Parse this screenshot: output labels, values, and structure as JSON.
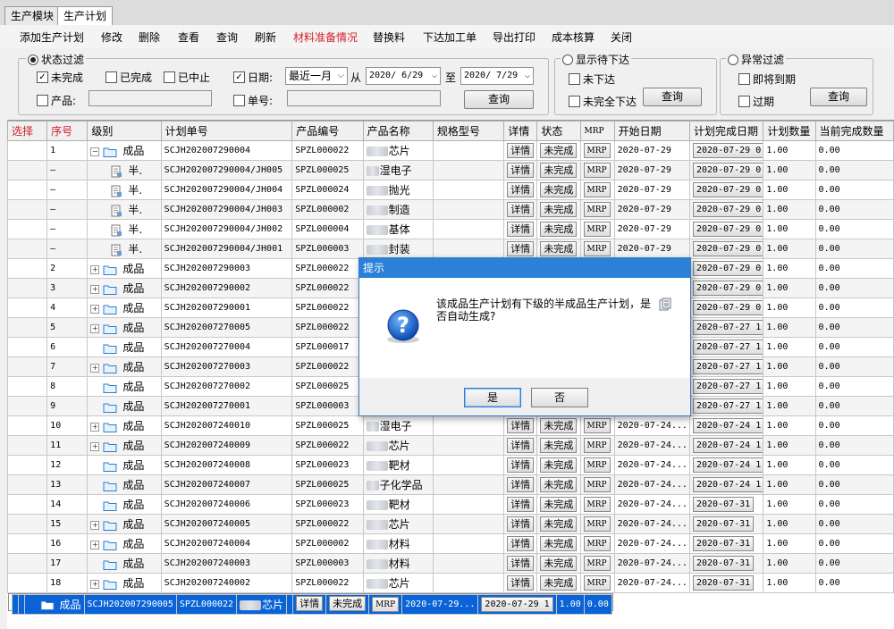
{
  "tabs": [
    "生产模块",
    "生产计划"
  ],
  "toolbar": [
    {
      "label": "添加生产计划",
      "color": "#000000"
    },
    {
      "label": "修改",
      "color": "#000000"
    },
    {
      "label": "删除",
      "color": "#000000"
    },
    {
      "label": "查看",
      "color": "#000000"
    },
    {
      "label": "查询",
      "color": "#000000"
    },
    {
      "label": "刷新",
      "color": "#000000"
    },
    {
      "label": "材料准备情况",
      "color": "#d0202a"
    },
    {
      "label": "替换料",
      "color": "#000000"
    },
    {
      "label": "下达加工单",
      "color": "#000000"
    },
    {
      "label": "导出打印",
      "color": "#000000"
    },
    {
      "label": "成本核算",
      "color": "#000000"
    },
    {
      "label": "关闭",
      "color": "#000000"
    }
  ],
  "filters": {
    "status": {
      "title": "状态过滤",
      "unfinished": "未完成",
      "completed": "已完成",
      "stopped": "已中止",
      "product_label": "产品:",
      "product_value": ""
    },
    "date": {
      "check_label": "日期:",
      "range": "最近一月",
      "from_label": "从",
      "from": "2020/ 6/29",
      "to_label": "至",
      "to": "2020/ 7/29",
      "order_label": "单号:",
      "order_value": "",
      "query": "查询"
    },
    "pending": {
      "title": "显示待下达",
      "not_issued": "未下达",
      "partial": "未完全下达",
      "query": "查询"
    },
    "abnormal": {
      "title": "异常过滤",
      "due_soon": "即将到期",
      "overdue": "过期",
      "query": "查询"
    }
  },
  "columns": [
    "选择",
    "序号",
    "级别",
    "计划单号",
    "产品编号",
    "产品名称",
    "规格型号",
    "详情",
    "状态",
    "MRP",
    "开始日期",
    "计划完成日期",
    "计划数量",
    "当前完成数量"
  ],
  "rows": [
    {
      "seq": "1",
      "level": "成品",
      "plan": "SCJH202007290004",
      "code": "SPZL000022",
      "name": "芯片",
      "detail": "详情",
      "status": "未完成",
      "mrp": "MRP",
      "start": "2020-07-29",
      "due": "2020-07-29 0",
      "qty": "1.00",
      "done": "0.00"
    },
    {
      "seq": "—",
      "level": "半.",
      "plan": "SCJH202007290004/JH005",
      "code": "SPZL000025",
      "name": "湿电子",
      "detail": "详情",
      "status": "未完成",
      "mrp": "MRP",
      "start": "2020-07-29",
      "due": "2020-07-29 0",
      "qty": "1.00",
      "done": "0.00"
    },
    {
      "seq": "—",
      "level": "半.",
      "plan": "SCJH202007290004/JH004",
      "code": "SPZL000024",
      "name": "抛光",
      "detail": "详情",
      "status": "未完成",
      "mrp": "MRP",
      "start": "2020-07-29",
      "due": "2020-07-29 0",
      "qty": "1.00",
      "done": "0.00"
    },
    {
      "seq": "—",
      "level": "半.",
      "plan": "SCJH202007290004/JH003",
      "code": "SPZL000002",
      "name": "制造",
      "detail": "详情",
      "status": "未完成",
      "mrp": "MRP",
      "start": "2020-07-29",
      "due": "2020-07-29 0",
      "qty": "1.00",
      "done": "0.00"
    },
    {
      "seq": "—",
      "level": "半.",
      "plan": "SCJH202007290004/JH002",
      "code": "SPZL000004",
      "name": "基体",
      "detail": "详情",
      "status": "未完成",
      "mrp": "MRP",
      "start": "2020-07-29",
      "due": "2020-07-29 0",
      "qty": "1.00",
      "done": "0.00"
    },
    {
      "seq": "—",
      "level": "半.",
      "plan": "SCJH202007290004/JH001",
      "code": "SPZL000003",
      "name": "封装",
      "detail": "详情",
      "status": "未完成",
      "mrp": "MRP",
      "start": "2020-07-29",
      "due": "2020-07-29 0",
      "qty": "1.00",
      "done": "0.00"
    },
    {
      "seq": "2",
      "level": "成品",
      "plan": "SCJH202007290003",
      "code": "SPZL000022",
      "name": "",
      "detail": "",
      "status": "",
      "mrp": "",
      "start": "",
      "due": "2020-07-29 0",
      "qty": "1.00",
      "done": "0.00"
    },
    {
      "seq": "3",
      "level": "成品",
      "plan": "SCJH202007290002",
      "code": "SPZL000022",
      "name": "",
      "detail": "",
      "status": "",
      "mrp": "",
      "start": "",
      "due": "2020-07-29 0",
      "qty": "1.00",
      "done": "0.00"
    },
    {
      "seq": "4",
      "level": "成品",
      "plan": "SCJH202007290001",
      "code": "SPZL000022",
      "name": "",
      "detail": "",
      "status": "",
      "mrp": "",
      "start": "",
      "due": "2020-07-29 0",
      "qty": "1.00",
      "done": "0.00"
    },
    {
      "seq": "5",
      "level": "成品",
      "plan": "SCJH202007270005",
      "code": "SPZL000022",
      "name": "",
      "detail": "",
      "status": "",
      "mrp": "",
      "start": "",
      "due": "2020-07-27 1",
      "qty": "1.00",
      "done": "0.00"
    },
    {
      "seq": "6",
      "level": "成品",
      "plan": "SCJH202007270004",
      "code": "SPZL000017",
      "name": "",
      "detail": "",
      "status": "",
      "mrp": "",
      "start": "",
      "due": "2020-07-27 1",
      "qty": "1.00",
      "done": "0.00"
    },
    {
      "seq": "7",
      "level": "成品",
      "plan": "SCJH202007270003",
      "code": "SPZL000022",
      "name": "",
      "detail": "",
      "status": "",
      "mrp": "",
      "start": "",
      "due": "2020-07-27 1",
      "qty": "1.00",
      "done": "0.00"
    },
    {
      "seq": "8",
      "level": "成品",
      "plan": "SCJH202007270002",
      "code": "SPZL000025",
      "name": "",
      "detail": "",
      "status": "",
      "mrp": "",
      "start": "",
      "due": "2020-07-27 1",
      "qty": "1.00",
      "done": "0.00"
    },
    {
      "seq": "9",
      "level": "成品",
      "plan": "SCJH202007270001",
      "code": "SPZL000003",
      "name": "",
      "detail": "",
      "status": "",
      "mrp": "",
      "start": "",
      "due": "2020-07-27 1",
      "qty": "1.00",
      "done": "0.00"
    },
    {
      "seq": "10",
      "level": "成品",
      "plan": "SCJH202007240010",
      "code": "SPZL000025",
      "name": "湿电子",
      "detail": "详情",
      "status": "未完成",
      "mrp": "MRP",
      "start": "2020-07-24...",
      "due": "2020-07-24 1",
      "qty": "1.00",
      "done": "0.00"
    },
    {
      "seq": "11",
      "level": "成品",
      "plan": "SCJH202007240009",
      "code": "SPZL000022",
      "name": "芯片",
      "detail": "详情",
      "status": "未完成",
      "mrp": "MRP",
      "start": "2020-07-24...",
      "due": "2020-07-24 1",
      "qty": "1.00",
      "done": "0.00"
    },
    {
      "seq": "12",
      "level": "成品",
      "plan": "SCJH202007240008",
      "code": "SPZL000023",
      "name": "靶材",
      "detail": "详情",
      "status": "未完成",
      "mrp": "MRP",
      "start": "2020-07-24...",
      "due": "2020-07-24 1",
      "qty": "1.00",
      "done": "0.00"
    },
    {
      "seq": "13",
      "level": "成品",
      "plan": "SCJH202007240007",
      "code": "SPZL000025",
      "name": "子化学品",
      "detail": "详情",
      "status": "未完成",
      "mrp": "MRP",
      "start": "2020-07-24...",
      "due": "2020-07-24 1",
      "qty": "1.00",
      "done": "0.00"
    },
    {
      "seq": "14",
      "level": "成品",
      "plan": "SCJH202007240006",
      "code": "SPZL000023",
      "name": "靶材",
      "detail": "详情",
      "status": "未完成",
      "mrp": "MRP",
      "start": "2020-07-24...",
      "due": "2020-07-31",
      "qty": "1.00",
      "done": "0.00"
    },
    {
      "seq": "15",
      "level": "成品",
      "plan": "SCJH202007240005",
      "code": "SPZL000022",
      "name": "芯片",
      "detail": "详情",
      "status": "未完成",
      "mrp": "MRP",
      "start": "2020-07-24...",
      "due": "2020-07-31",
      "qty": "1.00",
      "done": "0.00"
    },
    {
      "seq": "16",
      "level": "成品",
      "plan": "SCJH202007240004",
      "code": "SPZL000002",
      "name": "材料",
      "detail": "详情",
      "status": "未完成",
      "mrp": "MRP",
      "start": "2020-07-24...",
      "due": "2020-07-31",
      "qty": "1.00",
      "done": "0.00"
    },
    {
      "seq": "17",
      "level": "成品",
      "plan": "SCJH202007240003",
      "code": "SPZL000003",
      "name": "材料",
      "detail": "详情",
      "status": "未完成",
      "mrp": "MRP",
      "start": "2020-07-24...",
      "due": "2020-07-31",
      "qty": "1.00",
      "done": "0.00"
    },
    {
      "seq": "18",
      "level": "成品",
      "plan": "SCJH202007240002",
      "code": "SPZL000022",
      "name": "芯片",
      "detail": "详情",
      "status": "未完成",
      "mrp": "MRP",
      "start": "2020-07-24...",
      "due": "2020-07-31",
      "qty": "1.00",
      "done": "0.00"
    },
    {
      "seq": "",
      "level": "成品",
      "plan": "SCJH202007290005",
      "code": "SPZL000022",
      "name": "芯片",
      "detail": "详情",
      "status": "未完成",
      "mrp": "MRP",
      "start": "2020-07-29...",
      "due": "2020-07-29 1",
      "qty": "1.00",
      "done": "0.00"
    }
  ],
  "dialog": {
    "title": "提示",
    "message": "该成品生产计划有下级的半成品生产计划，是否自动生成?",
    "yes": "是",
    "no": "否"
  },
  "colors": {
    "accent": "#0a64d8",
    "dialog_title": "#2b80d8",
    "highlight_text": "#d0202a"
  }
}
